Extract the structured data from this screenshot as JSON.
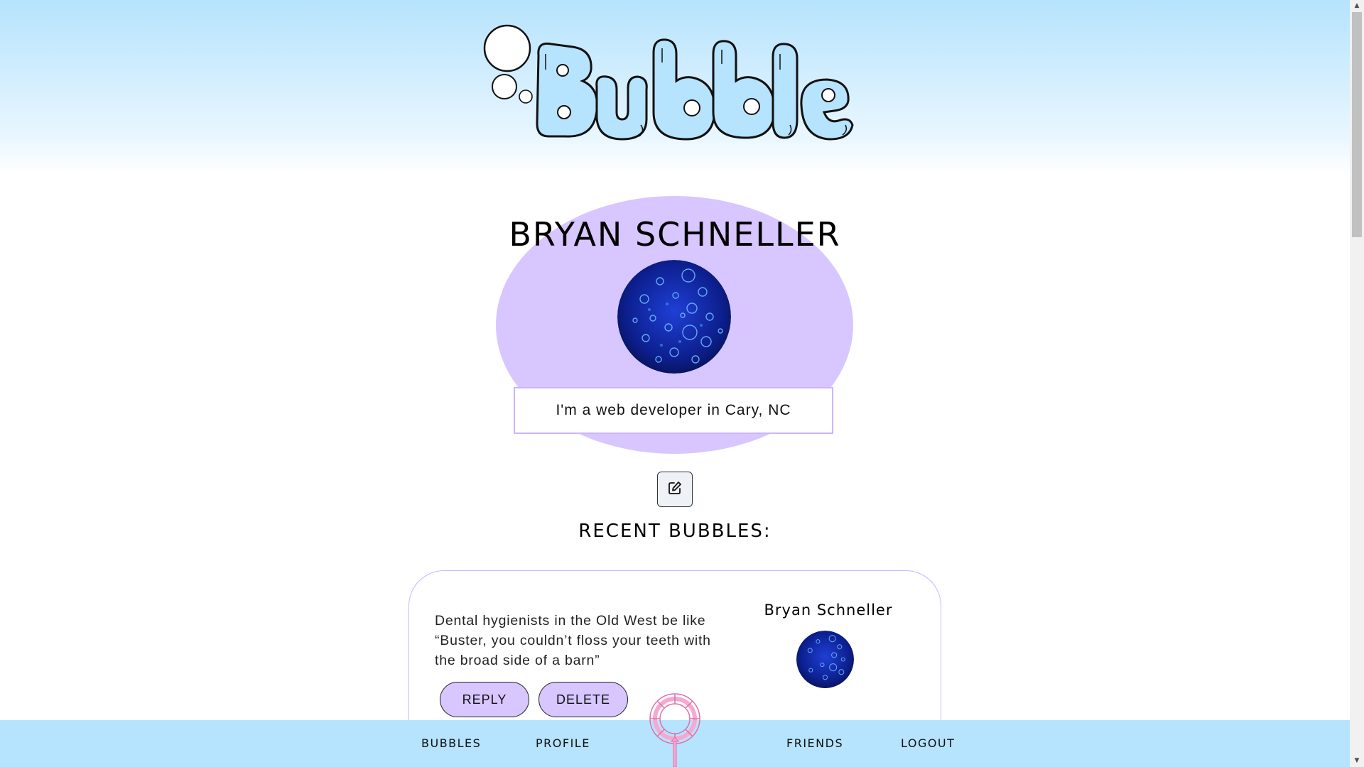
{
  "app": {
    "logo_text": "Bubble"
  },
  "profile": {
    "name": "BRYAN SCHNELLER",
    "bio": "I'm a web developer in Cary, NC"
  },
  "icons": {
    "edit": "edit-icon",
    "wand": "bubble-wand-icon",
    "avatar": "blue-bubbles-avatar"
  },
  "recent": {
    "title": "RECENT BUBBLES:",
    "posts": [
      {
        "text": "Dental hygienists in the Old West be like “Buster, you couldn’t floss your teeth with the broad side of a barn”",
        "author": "Bryan Schneller",
        "reply_label": "REPLY",
        "delete_label": "DELETE"
      }
    ]
  },
  "nav": {
    "bubbles": "BUBBLES",
    "profile": "PROFILE",
    "friends": "FRIENDS",
    "logout": "LOGOUT"
  },
  "colors": {
    "sky": "#b6e3fd",
    "lavender": "#d7c6ff",
    "lavender_border": "#cbb5ff",
    "wand_pink": "#f7a8d0"
  }
}
